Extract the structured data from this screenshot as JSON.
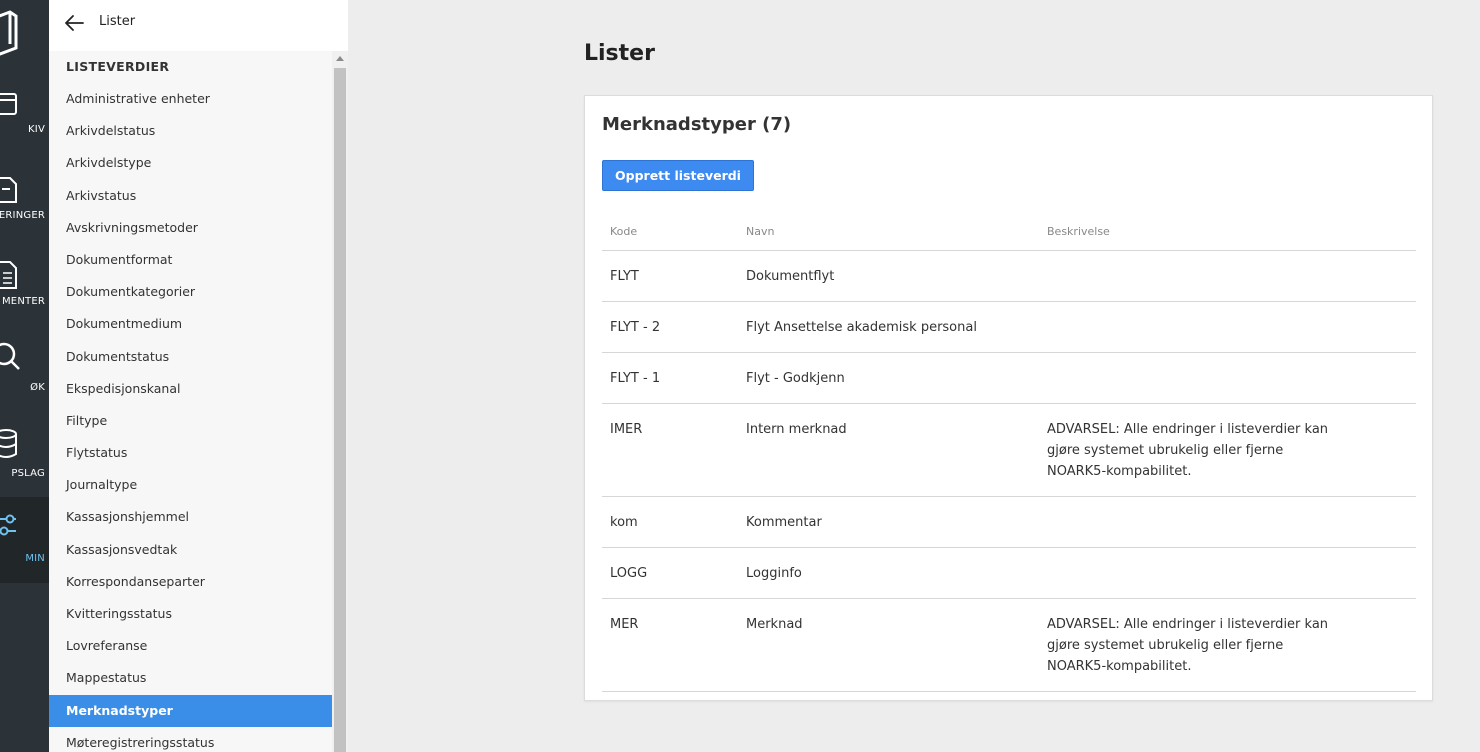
{
  "rail": {
    "items": [
      {
        "label": "KIV",
        "icon": "archive-box-icon"
      },
      {
        "label": "ERINGER",
        "icon": "folder-register-icon"
      },
      {
        "label": "MENTER",
        "icon": "document-icon"
      },
      {
        "label": "ØK",
        "icon": "search-icon"
      },
      {
        "label": "PSLAG",
        "icon": "database-icon"
      },
      {
        "label": "MIN",
        "icon": "sliders-icon"
      }
    ],
    "accent": "#6fc1f0"
  },
  "sidebar": {
    "title": "Lister",
    "section": "LISTEVERDIER",
    "items": [
      "Administrative enheter",
      "Arkivdelstatus",
      "Arkivdelstype",
      "Arkivstatus",
      "Avskrivningsmetoder",
      "Dokumentformat",
      "Dokumentkategorier",
      "Dokumentmedium",
      "Dokumentstatus",
      "Ekspedisjonskanal",
      "Filtype",
      "Flytstatus",
      "Journaltype",
      "Kassasjonshjemmel",
      "Kassasjonsvedtak",
      "Korrespondanseparter",
      "Kvitteringsstatus",
      "Lovreferanse",
      "Mappestatus",
      "Merknadstyper",
      "Møteregistreringsstatus"
    ],
    "active_item": "Merknadstyper",
    "active_color": "#3b8ee7"
  },
  "main": {
    "page_title": "Lister",
    "card_title": "Merknadstyper (7)",
    "create_button": "Opprett listeverdi",
    "columns": [
      "Kode",
      "Navn",
      "Beskrivelse"
    ],
    "rows": [
      {
        "kode": "FLYT",
        "navn": "Dokumentflyt",
        "beskrivelse": ""
      },
      {
        "kode": "FLYT - 2",
        "navn": "Flyt Ansettelse akademisk personal",
        "beskrivelse": ""
      },
      {
        "kode": "FLYT - 1",
        "navn": "Flyt - Godkjenn",
        "beskrivelse": ""
      },
      {
        "kode": "IMER",
        "navn": "Intern merknad",
        "beskrivelse": "ADVARSEL: Alle endringer i listeverdier kan gjøre systemet ubrukelig eller fjerne NOARK5-kompabilitet."
      },
      {
        "kode": "kom",
        "navn": "Kommentar",
        "beskrivelse": ""
      },
      {
        "kode": "LOGG",
        "navn": "Logginfo",
        "beskrivelse": ""
      },
      {
        "kode": "MER",
        "navn": "Merknad",
        "beskrivelse": "ADVARSEL: Alle endringer i listeverdier kan gjøre systemet ubrukelig eller fjerne NOARK5-kompabilitet."
      }
    ],
    "button_color": "#3d8af0"
  }
}
